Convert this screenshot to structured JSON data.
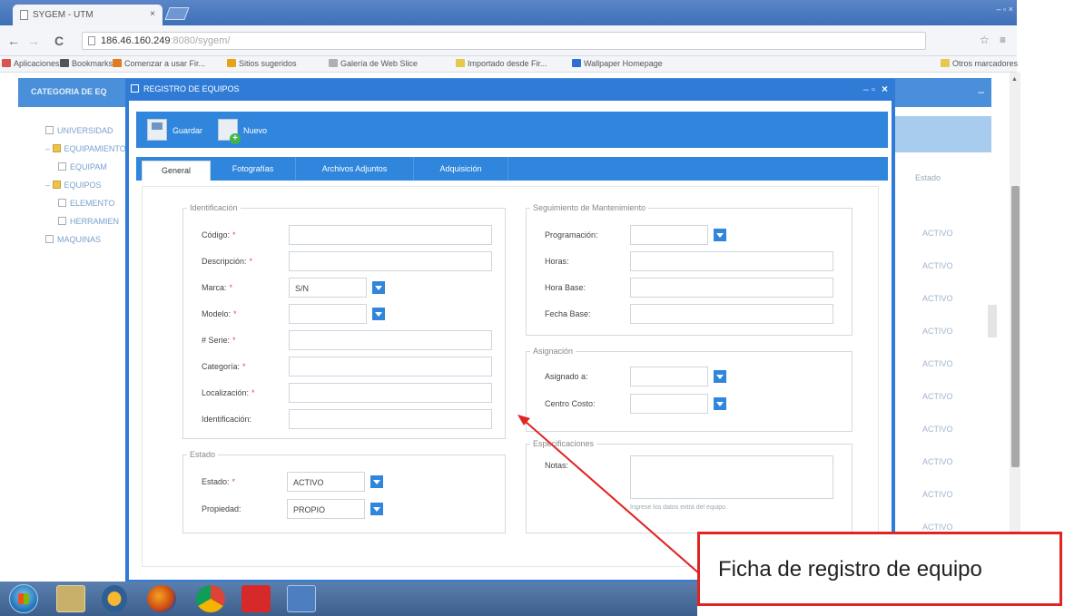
{
  "browser": {
    "tab_title": "SYGEM - UTM",
    "tab_close": "×",
    "win_controls": "– ▫ ×",
    "nav_back": "←",
    "nav_forward": "→",
    "nav_reload": "C",
    "url_host": "186.46.160.249",
    "url_rest": ":8080/sygem/",
    "addr_tools": "☆ ≡",
    "bookmarks": [
      {
        "label": "Aplicaciones",
        "color": "#d9534f"
      },
      {
        "label": "Bookmarks",
        "color": "#555555"
      },
      {
        "label": "Comenzar a usar Fir...",
        "color": "#e07b22"
      },
      {
        "label": "Sitios sugeridos",
        "color": "#e8a21a"
      },
      {
        "label": "Galería de Web Slice",
        "color": "#b0b0b0"
      },
      {
        "label": "Importado desde Fir...",
        "color": "#e8c84a"
      },
      {
        "label": "Wallpaper Homepage",
        "color": "#2f6fd0"
      }
    ],
    "other_bookmarks": "Otros marcadores"
  },
  "background_app": {
    "header_title": "CATEGORIA DE EQ",
    "collapse_icon": "–",
    "tree": [
      {
        "label": "UNIVERSIDAD",
        "indent": 0,
        "icon": "lock-icon"
      },
      {
        "label": "EQUIPAMIENTO",
        "indent": 0,
        "icon": "folder-icon",
        "prefix": "–"
      },
      {
        "label": "EQUIPAM",
        "indent": 1,
        "icon": "page-icon"
      },
      {
        "label": "EQUIPOS",
        "indent": 0,
        "icon": "folder-icon",
        "prefix": "–"
      },
      {
        "label": "ELEMENTO",
        "indent": 1,
        "icon": "page-icon"
      },
      {
        "label": "HERRAMIEN",
        "indent": 1,
        "icon": "page-icon"
      },
      {
        "label": "MAQUINAS",
        "indent": 0,
        "icon": "page-icon"
      }
    ],
    "column_estado": "Estado",
    "status_values": [
      "ACTIVO",
      "ACTIVO",
      "ACTIVO",
      "ACTIVO",
      "ACTIVO",
      "ACTIVO",
      "ACTIVO",
      "ACTIVO",
      "ACTIVO",
      "ACTIVO"
    ]
  },
  "modal": {
    "title": "REGISTRO DE EQUIPOS",
    "controls_min": "– ▫",
    "controls_close": "×",
    "toolbar": {
      "save_label": "Guardar",
      "new_label": "Nuevo"
    },
    "tabs": [
      "General",
      "Fotografías",
      "Archivos Adjuntos",
      "Adquisición"
    ],
    "identificacion": {
      "legend": "Identificación",
      "fields": [
        {
          "label": "Código:",
          "required": true,
          "value": "",
          "type": "text"
        },
        {
          "label": "Descripción:",
          "required": true,
          "value": "",
          "type": "text"
        },
        {
          "label": "Marca:",
          "required": true,
          "value": "S/N",
          "type": "select"
        },
        {
          "label": "Modelo:",
          "required": true,
          "value": "",
          "type": "select"
        },
        {
          "label": "# Serie:",
          "required": true,
          "value": "",
          "type": "text"
        },
        {
          "label": "Categoría:",
          "required": true,
          "value": "",
          "type": "text"
        },
        {
          "label": "Localización:",
          "required": true,
          "value": "",
          "type": "text"
        },
        {
          "label": "Identificación:",
          "required": false,
          "value": "",
          "type": "text"
        }
      ]
    },
    "estado": {
      "legend": "Estado",
      "fields": [
        {
          "label": "Estado:",
          "required": true,
          "value": "ACTIVO",
          "type": "select"
        },
        {
          "label": "Propiedad:",
          "required": false,
          "value": "PROPIO",
          "type": "select"
        }
      ]
    },
    "mantenimiento": {
      "legend": "Seguimiento de Mantenimiento",
      "fields": [
        {
          "label": "Programación:",
          "value": "",
          "type": "select"
        },
        {
          "label": "Horas:",
          "value": "",
          "type": "text"
        },
        {
          "label": "Hora Base:",
          "value": "",
          "type": "text"
        },
        {
          "label": "Fecha Base:",
          "value": "",
          "type": "text"
        }
      ]
    },
    "asignacion": {
      "legend": "Asignación",
      "fields": [
        {
          "label": "Asignado a:",
          "value": "",
          "type": "select"
        },
        {
          "label": "Centro Costo:",
          "value": "",
          "type": "select"
        }
      ]
    },
    "especificaciones": {
      "legend": "Especificaciones",
      "notes_label": "Notas:",
      "notes_value": "",
      "hint": "Ingrese los datos extra del equipo."
    }
  },
  "annotation": {
    "callout_text": "Ficha de registro de equipo",
    "color": "#e02424"
  },
  "taskbar": {
    "items": [
      "start-orb",
      "explorer-icon",
      "media-player-icon",
      "firefox-icon",
      "chrome-icon",
      "acrobat-icon",
      "app-icon"
    ]
  },
  "colors": {
    "primary": "#2f86dc",
    "header": "#2f7bd6",
    "required": "#e05050"
  }
}
